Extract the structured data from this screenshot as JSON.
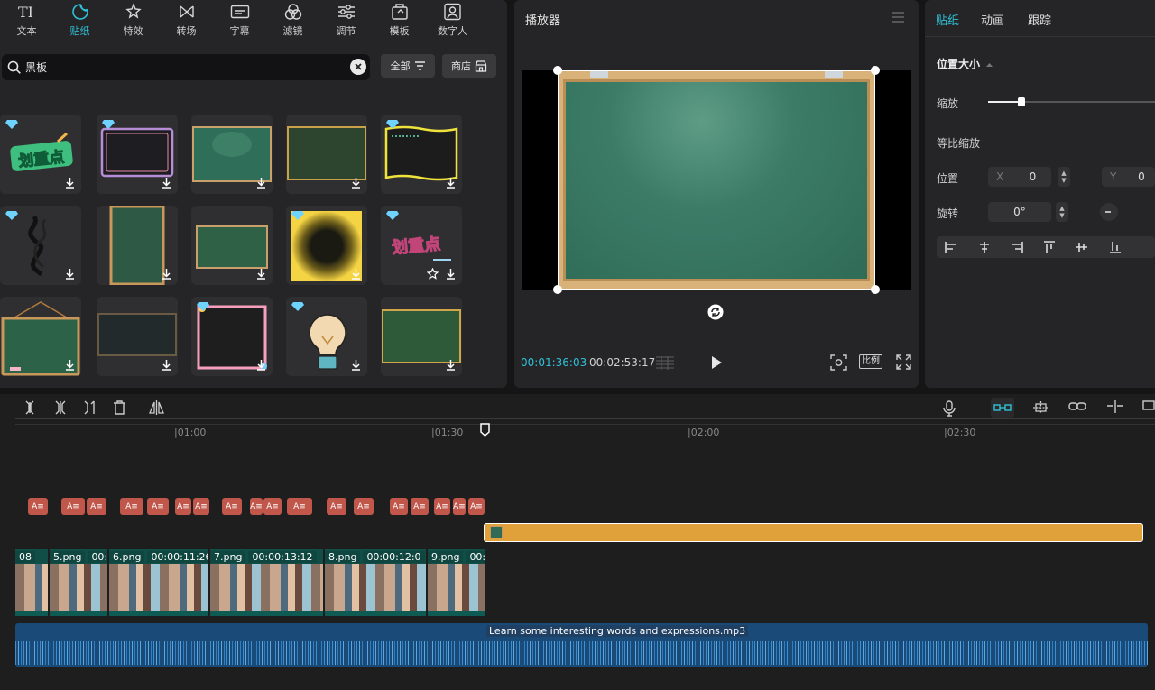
{
  "toolbar": [
    {
      "label": "文本",
      "icon": "text-icon"
    },
    {
      "label": "贴纸",
      "icon": "sticker-icon",
      "active": true
    },
    {
      "label": "特效",
      "icon": "effects-icon"
    },
    {
      "label": "转场",
      "icon": "transition-icon"
    },
    {
      "label": "字幕",
      "icon": "subtitle-icon"
    },
    {
      "label": "滤镜",
      "icon": "filter-icon"
    },
    {
      "label": "调节",
      "icon": "adjust-icon"
    },
    {
      "label": "模板",
      "icon": "template-icon"
    },
    {
      "label": "数字人",
      "icon": "digital-human-icon"
    }
  ],
  "search": {
    "query": "黑板"
  },
  "filter": {
    "label": "全部"
  },
  "store": {
    "label": "商店"
  },
  "stickers": [
    {
      "kind": "text-badge",
      "text": "划重点",
      "premium": true
    },
    {
      "kind": "frame-pink",
      "premium": true
    },
    {
      "kind": "board-green"
    },
    {
      "kind": "board-dark-gold"
    },
    {
      "kind": "frame-yellow",
      "premium": true
    },
    {
      "kind": "calligraphy",
      "premium": true
    },
    {
      "kind": "board-portrait"
    },
    {
      "kind": "board-small"
    },
    {
      "kind": "glow-yellow",
      "premium": true
    },
    {
      "kind": "text-pink",
      "text": "划重点",
      "premium": true,
      "favorite": true
    },
    {
      "kind": "board-hanging"
    },
    {
      "kind": "board-black"
    },
    {
      "kind": "frame-flowers",
      "premium": true
    },
    {
      "kind": "lightbulb",
      "premium": true
    },
    {
      "kind": "board-gold-frame"
    }
  ],
  "player": {
    "title": "播放器",
    "current_time": "00:01:36:03",
    "total_time": "00:02:53:17",
    "ratio_label": "比例"
  },
  "properties": {
    "tabs": [
      "贴纸",
      "动画",
      "跟踪"
    ],
    "section": "位置大小",
    "scale_label": "缩放",
    "scale_value": 0.2,
    "uniform_label": "等比缩放",
    "position_label": "位置",
    "x_tag": "X",
    "x_value": "0",
    "y_tag": "Y",
    "y_value": "0",
    "rotation_label": "旋转",
    "rotation_value": "0°"
  },
  "timeline": {
    "ruler": [
      "|01:00",
      "|01:30",
      "|02:00",
      "|02:30"
    ],
    "text_clip_label": "A≡",
    "video_clips": [
      {
        "name": "",
        "duration": "08"
      },
      {
        "name": "5.png",
        "duration": "00:0"
      },
      {
        "name": "6.png",
        "duration": "00:00:11:26"
      },
      {
        "name": "7.png",
        "duration": "00:00:13:12"
      },
      {
        "name": "8.png",
        "duration": "00:00:12:0"
      },
      {
        "name": "9.png",
        "duration": "00:0"
      }
    ],
    "audio_clip": "Learn some interesting words and expressions.mp3"
  },
  "colors": {
    "accent": "#2fc1d7",
    "sticker_clip": "#e0a03a",
    "audio_clip": "#1a4a78",
    "text_clip": "#c1574a"
  }
}
